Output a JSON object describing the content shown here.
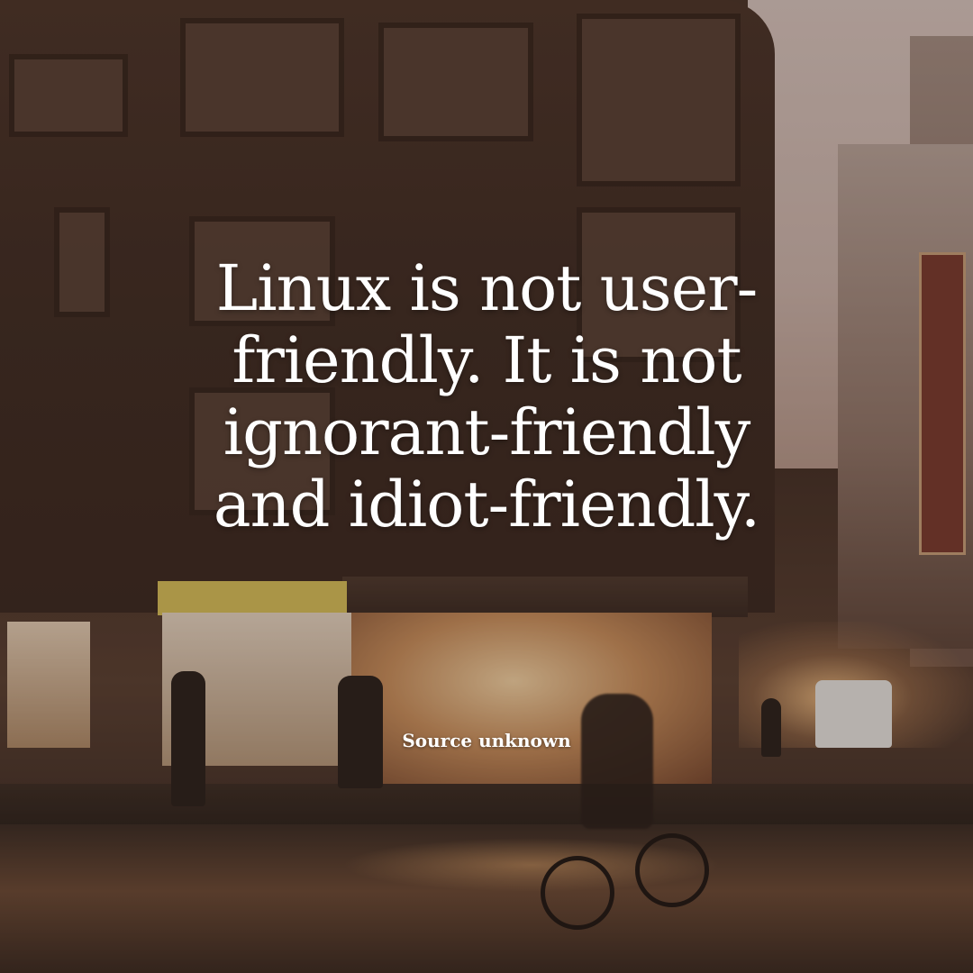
{
  "quote": {
    "text": "Linux is not user-friendly. It is not ignorant-friendly and idiot-friendly."
  },
  "attribution": {
    "source": "Source unknown"
  },
  "background": {
    "description_icon": "street-scene-photo",
    "tone_color": "#4a3429"
  }
}
